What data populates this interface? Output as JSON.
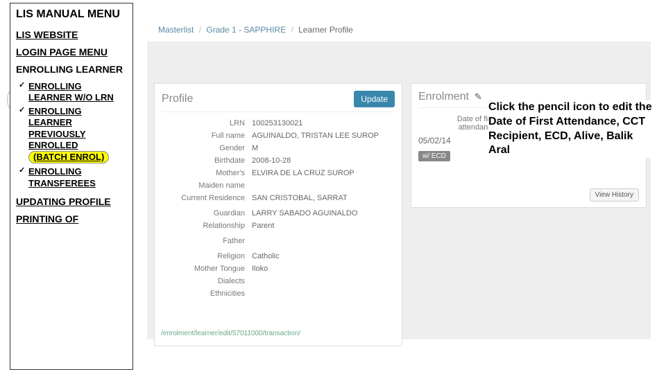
{
  "sidebar": {
    "title": "LIS MANUAL MENU",
    "links": {
      "website": "LIS WEBSITE",
      "login": "LOGIN PAGE MENU",
      "enrolling_head": "ENROLLING LEARNER",
      "updating": "UPDATING PROFILE",
      "printing": "PRINTING OF"
    },
    "items": [
      {
        "label": "ENROLLING LEARNER W/O LRN"
      },
      {
        "label_pre": "ENROLLING LEARNER PREVIOUSLY ENROLLED",
        "label_h": "(BATCH ENROL)"
      },
      {
        "label": "ENROLLING TRANSFEREES"
      }
    ]
  },
  "breadcrumb": {
    "a": "Masterlist",
    "b": "Grade 1 - SAPPHIRE",
    "c": "Learner Profile"
  },
  "profile": {
    "title": "Profile",
    "update": "Update",
    "fields": {
      "lrn": {
        "label": "LRN",
        "value": "100253130021"
      },
      "fullname": {
        "label": "Full name",
        "value": "AGUINALDO, TRISTAN LEE SUROP"
      },
      "gender": {
        "label": "Gender",
        "value": "M"
      },
      "birthdate": {
        "label": "Birthdate",
        "value": "2008-10-28"
      },
      "mother": {
        "label": "Mother's",
        "value": "ELVIRA DE LA CRUZ SUROP"
      },
      "maiden": {
        "label": "Maiden name",
        "value": ""
      },
      "residence": {
        "label": "Current Residence",
        "value": "SAN CRISTOBAL, SARRAT"
      },
      "guardian": {
        "label": "Guardian",
        "value": "LARRY SABADO AGUINALDO"
      },
      "relationship": {
        "label": "Relationship",
        "value": "Parent"
      },
      "father": {
        "label": "Father",
        "value": ""
      },
      "religion": {
        "label": "Religion",
        "value": "Catholic"
      },
      "tongue": {
        "label": "Mother Tongue",
        "value": "Iloko"
      },
      "dialects": {
        "label": "Dialects",
        "value": ""
      },
      "ethnicities": {
        "label": "Ethnicities",
        "value": ""
      }
    }
  },
  "enrolment": {
    "title": "Enrolment",
    "date_label": "Date of first attendance",
    "date_value": "05/02/14",
    "badge": "w/ ECD",
    "history": "View History"
  },
  "callout": "Click the pencil icon to edit the Date of First Attendance, CCT Recipient, ECD, Alive, Balik Aral",
  "url": "/enrolment/learner/edit/57011000/transaction/"
}
